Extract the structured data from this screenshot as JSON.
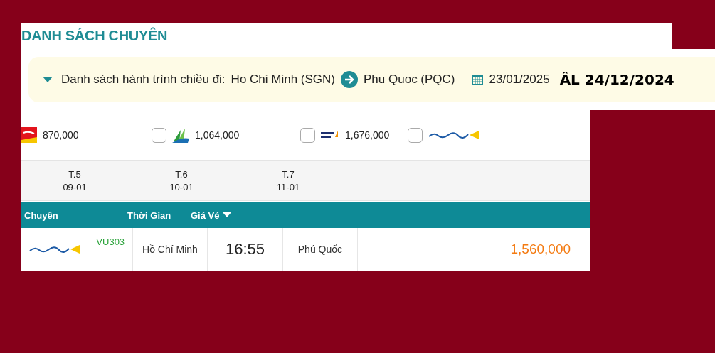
{
  "title": "DANH SÁCH CHUYÊN",
  "route": {
    "label": "Danh sách hành trình chiều đi:",
    "origin": "Ho Chi Minh (SGN)",
    "destination": "Phu Quoc (PQC)",
    "date": "23/01/2025",
    "lunar_date": "ÂL 24/12/2024",
    "expanded": true
  },
  "airlines": [
    {
      "kind": "vietjet",
      "price": "870,000"
    },
    {
      "kind": "bamboo",
      "price": "1,064,000",
      "checked": false
    },
    {
      "kind": "pacific",
      "price": "1,676,000",
      "checked": false
    },
    {
      "kind": "vietravel",
      "checked": false
    }
  ],
  "days": [
    {
      "weekday": "T.5",
      "date": "09-01"
    },
    {
      "weekday": "T.6",
      "date": "10-01"
    },
    {
      "weekday": "T.7",
      "date": "11-01"
    }
  ],
  "table": {
    "columns": [
      "Chuyến",
      "Thời Gian",
      "Giá Vé"
    ],
    "rows": [
      {
        "kind": "vietravel",
        "flight": "VU303",
        "from": "Hồ Chí Minh",
        "time": "16:55",
        "to": "Phú Quốc",
        "price": "1,560,000"
      }
    ]
  }
}
